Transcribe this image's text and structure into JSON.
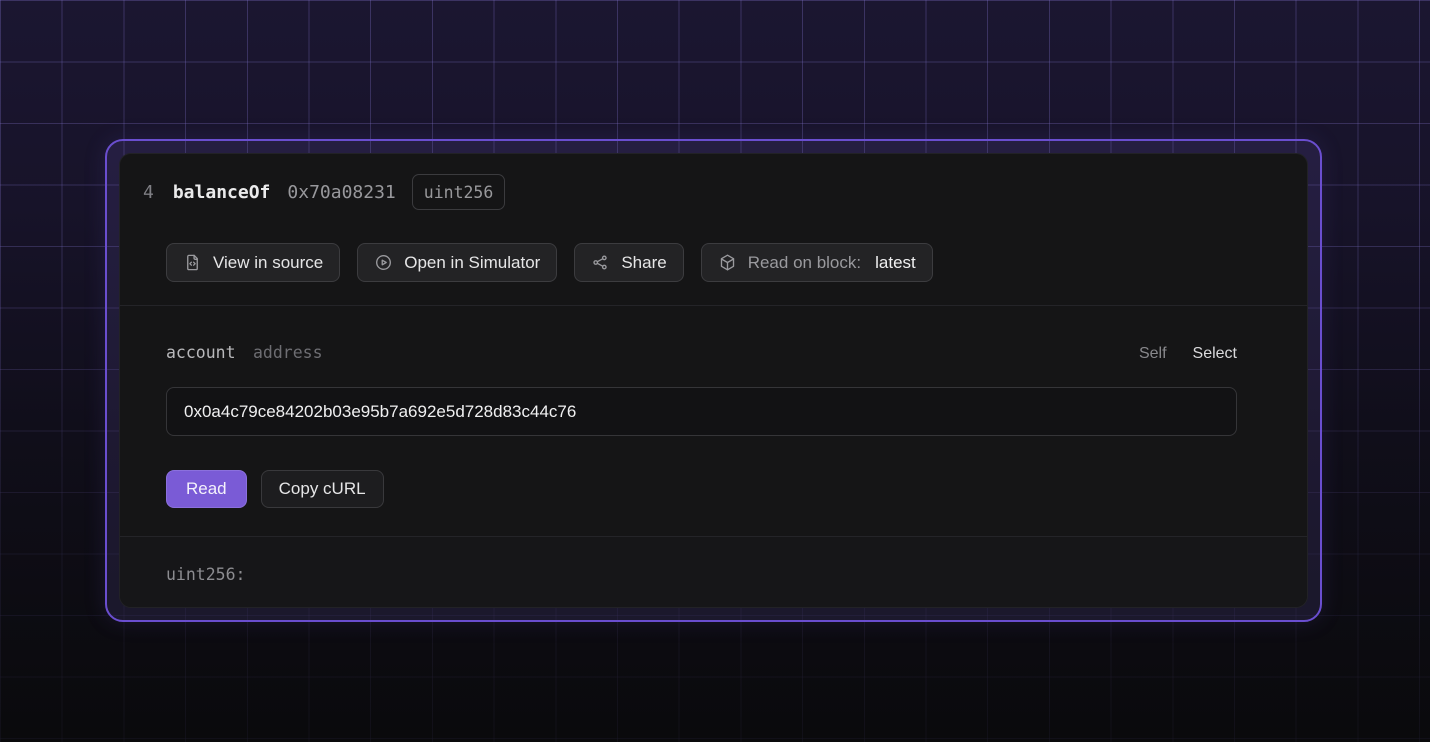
{
  "colors": {
    "accent_purple": "#7a5bd6",
    "wrapper_border": "#6a4ecf",
    "card_background": "#151516",
    "grid_line": "#8273cd"
  },
  "card": {
    "index": "4",
    "function_name": "balanceOf",
    "selector": "0x70a08231",
    "return_type_badge": "uint256",
    "actions": [
      {
        "icon": "file-code-icon",
        "label": "View in source"
      },
      {
        "icon": "play-circle-icon",
        "label": "Open in Simulator"
      },
      {
        "icon": "share-icon",
        "label": "Share"
      },
      {
        "icon": "cube-icon",
        "label": "Read on block:",
        "value": "latest"
      }
    ],
    "param": {
      "name": "account",
      "type": "address",
      "self_label": "Self",
      "select_label": "Select",
      "value": "0x0a4c79ce84202b03e95b7a692e5d728d83c44c76"
    },
    "read_button_label": "Read",
    "copy_curl_button_label": "Copy cURL",
    "result_label": "uint256:"
  }
}
